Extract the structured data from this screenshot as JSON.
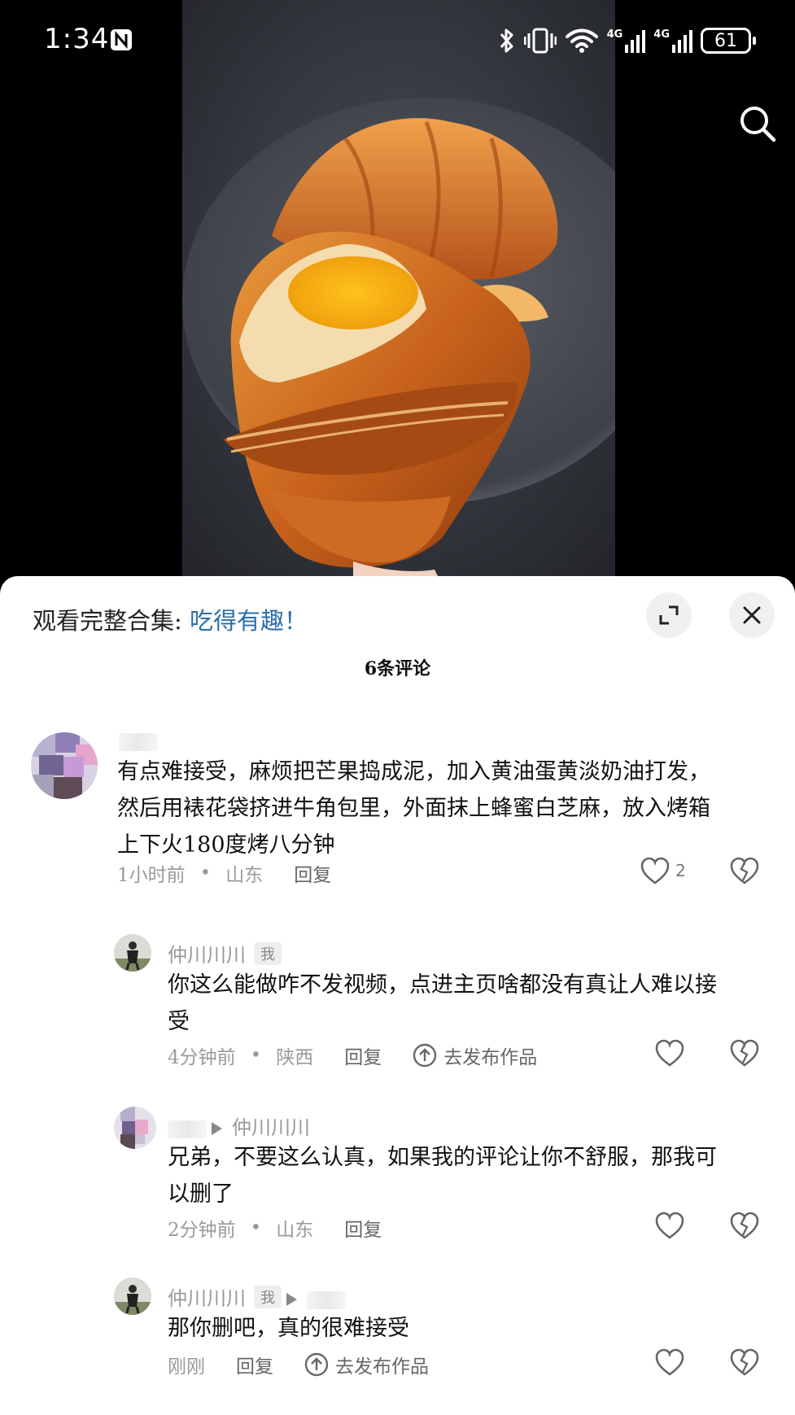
{
  "status_bar": {
    "time": "1:34",
    "battery": "61",
    "network_1": "4G",
    "network_2": "4G"
  },
  "video": {
    "description_icon": "search-icon"
  },
  "panel": {
    "collection_prefix": "观看完整合集:",
    "collection_link": "吃得有趣！",
    "comment_count": "6条评论"
  },
  "comments": [
    {
      "name": "",
      "text_lines": [
        "有点难接受，麻烦把芒果捣成泥，加入黄油蛋黄淡奶油打发，",
        "然后用裱花袋挤进牛角包里，外面抹上蜂蜜白芝麻，放入烤箱",
        "上下火180度烤八分钟"
      ],
      "time": "1小时前",
      "location": "山东",
      "reply_label": "回复",
      "likes": "2"
    },
    {
      "name": "仲川川川",
      "badge": "我",
      "text_lines": [
        "你这么能做咋不发视频，点进主页啥都没有真让人难以接",
        "受"
      ],
      "time": "4分钟前",
      "location": "陕西",
      "reply_label": "回复",
      "publish_label": "去发布作品"
    },
    {
      "name": "",
      "reply_to": "仲川川川",
      "text_lines": [
        "兄弟，不要这么认真，如果我的评论让你不舒服，那我可",
        "以删了"
      ],
      "time": "2分钟前",
      "location": "山东",
      "reply_label": "回复"
    },
    {
      "name": "仲川川川",
      "badge": "我",
      "text_lines": [
        "那你删吧，真的很难接受"
      ],
      "time": "刚刚",
      "reply_label": "回复",
      "publish_label": "去发布作品"
    }
  ]
}
